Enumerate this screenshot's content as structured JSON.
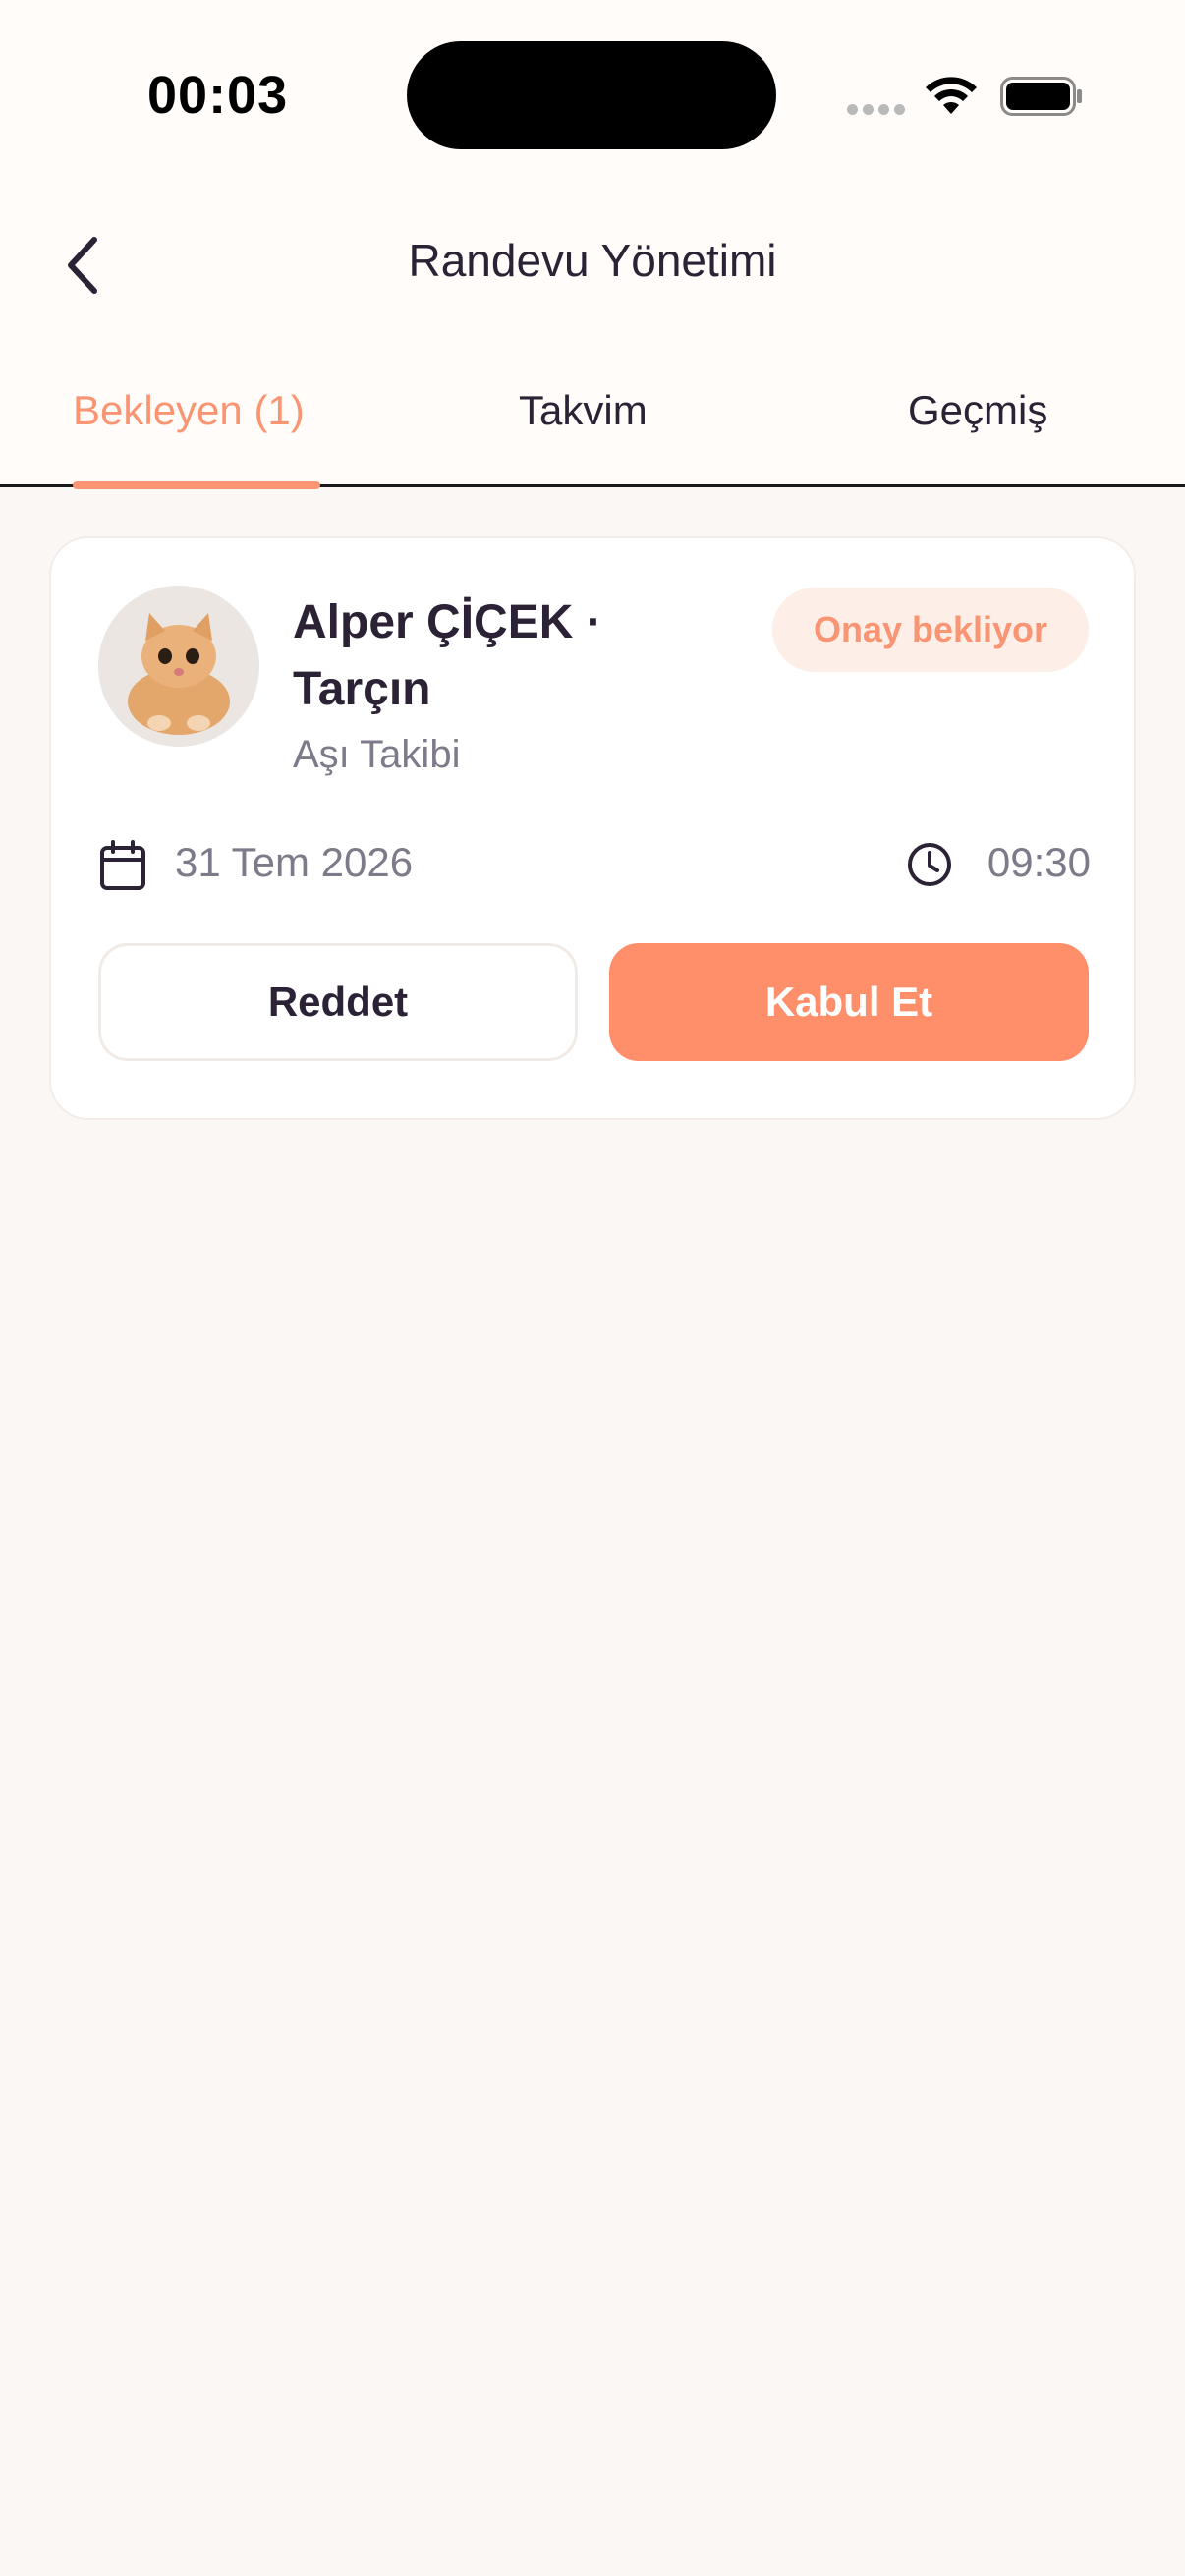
{
  "status_bar": {
    "time": "00:03",
    "icons": [
      "signal-dots-icon",
      "wifi-icon",
      "battery-icon"
    ]
  },
  "header": {
    "title": "Randevu Yönetimi",
    "back_icon": "chevron-left-icon"
  },
  "tabs": [
    {
      "label": "Bekleyen (1)",
      "active": true
    },
    {
      "label": "Takvim",
      "active": false
    },
    {
      "label": "Geçmiş",
      "active": false
    }
  ],
  "appointment": {
    "client_name": "Alper ÇİÇEK · Tarçın",
    "service": "Aşı Takibi",
    "status": "Onay bekliyor",
    "date": "31 Tem 2026",
    "time": "09:30",
    "reject_label": "Reddet",
    "accept_label": "Kabul Et"
  },
  "colors": {
    "accent": "#f99573",
    "accept_button": "#ff8f6a",
    "badge_bg": "#fdeee7",
    "text_dark": "#2b2236",
    "text_muted": "#7f7a8a",
    "background": "#faf7f5"
  }
}
